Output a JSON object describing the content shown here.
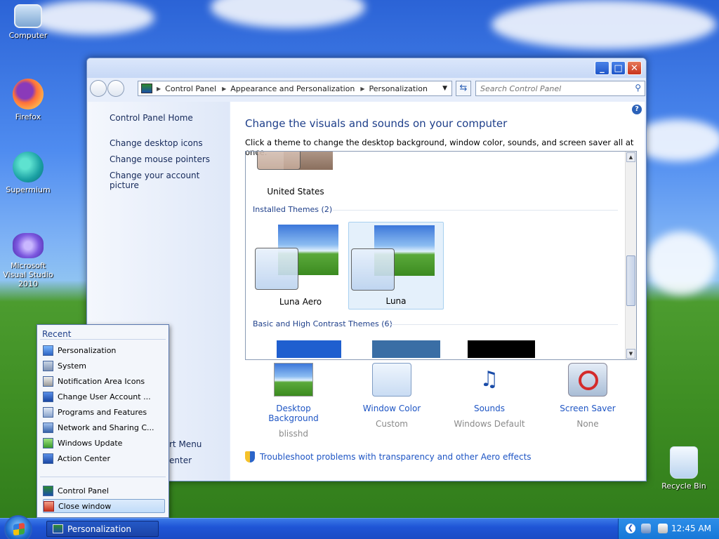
{
  "desktop": {
    "icons": [
      {
        "label": "Computer"
      },
      {
        "label": "Firefox"
      },
      {
        "label": "Supermium"
      },
      {
        "label": "Microsoft Visual Studio 2010"
      },
      {
        "label": "Recycle Bin"
      }
    ]
  },
  "window": {
    "breadcrumb": [
      "Control Panel",
      "Appearance and Personalization",
      "Personalization"
    ],
    "search_placeholder": "Search Control Panel",
    "help": "?",
    "left_links": {
      "home": "Control Panel Home",
      "desktop_icons": "Change desktop icons",
      "mouse_pointers": "Change mouse pointers",
      "account_picture": "Change your account picture"
    },
    "title": "Change the visuals and sounds on your computer",
    "intro": "Click a theme to change the desktop background, window color, sounds, and screen saver all at once.",
    "themes": {
      "partial_theme": "United States",
      "installed_header": "Installed Themes (2)",
      "installed": [
        {
          "name": "Luna Aero"
        },
        {
          "name": "Luna"
        }
      ],
      "basic_header": "Basic and High Contrast Themes (6)",
      "basic_colors": [
        "#1f5fcf",
        "#3a6ea5",
        "#000000"
      ]
    },
    "options": [
      {
        "title": "Desktop Background",
        "sub": "blisshd"
      },
      {
        "title": "Window Color",
        "sub": "Custom"
      },
      {
        "title": "Sounds",
        "sub": "Windows Default"
      },
      {
        "title": "Screen Saver",
        "sub": "None"
      }
    ],
    "troubleshoot": "Troubleshoot problems with transparency and other Aero effects"
  },
  "jumplist": {
    "recent_label": "Recent",
    "recent": [
      {
        "label": "Personalization"
      },
      {
        "label": "System"
      },
      {
        "label": "Notification Area Icons"
      },
      {
        "label": "Change User Account ..."
      },
      {
        "label": "Programs and Features"
      },
      {
        "label": "Network and Sharing C..."
      },
      {
        "label": "Windows Update"
      },
      {
        "label": "Action Center"
      }
    ],
    "tasks": [
      {
        "label": "Control Panel"
      },
      {
        "label": "Close window"
      }
    ]
  },
  "behind_text": {
    "start_menu": "rt Menu",
    "center": "enter"
  },
  "taskbar": {
    "active_task": "Personalization",
    "clock": "12:45 AM"
  }
}
